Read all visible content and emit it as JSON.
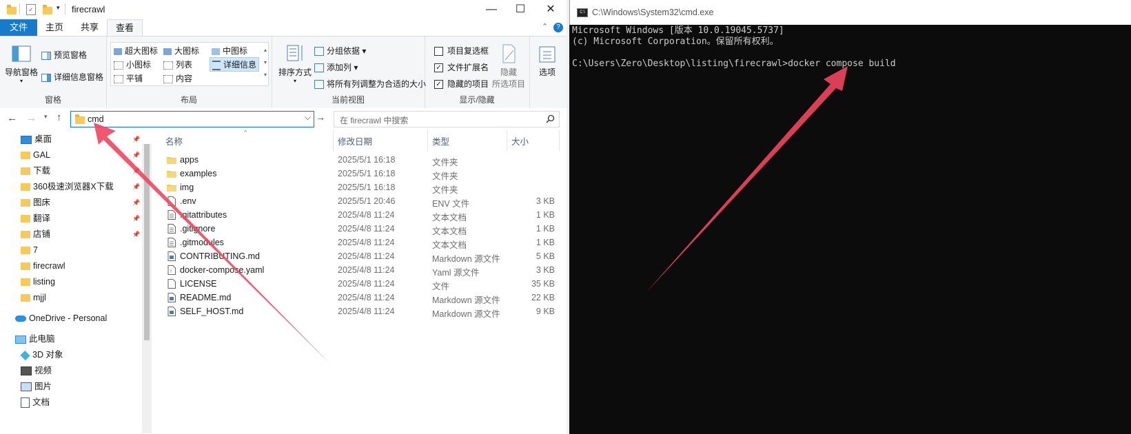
{
  "explorer": {
    "window_title": "firecrawl",
    "tabs": [
      {
        "label": "文件"
      },
      {
        "label": "主页"
      },
      {
        "label": "共享"
      },
      {
        "label": "查看"
      }
    ],
    "ribbon": {
      "pane": {
        "nav_pane": "导航窗格",
        "preview_pane": "预览窗格",
        "details_pane": "详细信息窗格",
        "group_label": "窗格"
      },
      "layout": {
        "xl_icons": "超大图标",
        "large_icons": "大图标",
        "medium_icons": "中图标",
        "small_icons": "小图标",
        "list": "列表",
        "details": "详细信息",
        "tiles": "平铺",
        "content": "内容",
        "group_label": "布局"
      },
      "current_view": {
        "sort_by": "排序方式",
        "group_by": "分组依据",
        "add_columns": "添加列",
        "size_all_columns": "将所有列调整为合适的大小",
        "group_label": "当前视图"
      },
      "show_hide": {
        "item_checkboxes": "项目复选框",
        "file_extensions": "文件扩展名",
        "hidden_items": "隐藏的项目",
        "hide": "隐藏",
        "hide_selected": "所选项目",
        "group_label": "显示/隐藏"
      },
      "options": "选项"
    },
    "address_value": "cmd",
    "search_placeholder": "在 firecrawl 中搜索",
    "sidebar": {
      "quick": [
        {
          "label": "桌面"
        },
        {
          "label": "GAL"
        },
        {
          "label": "下载"
        },
        {
          "label": "360极速浏览器X下载"
        },
        {
          "label": "图床"
        },
        {
          "label": "翻译"
        },
        {
          "label": "店铺"
        },
        {
          "label": "7"
        },
        {
          "label": "firecrawl"
        },
        {
          "label": "listing"
        },
        {
          "label": "mjjl"
        }
      ],
      "onedrive": "OneDrive - Personal",
      "this_pc": "此电脑",
      "pc_items": [
        {
          "label": "3D 对象"
        },
        {
          "label": "视频"
        },
        {
          "label": "图片"
        },
        {
          "label": "文档"
        }
      ]
    },
    "columns": {
      "name": "名称",
      "modified": "修改日期",
      "type": "类型",
      "size": "大小"
    },
    "files": [
      {
        "name": "apps",
        "date": "2025/5/1 16:18",
        "type": "文件夹",
        "size": "",
        "icon": "folder-icon"
      },
      {
        "name": "examples",
        "date": "2025/5/1 16:18",
        "type": "文件夹",
        "size": "",
        "icon": "folder-icon"
      },
      {
        "name": "img",
        "date": "2025/5/1 16:18",
        "type": "文件夹",
        "size": "",
        "icon": "folder-icon"
      },
      {
        "name": ".env",
        "date": "2025/5/1 20:46",
        "type": "ENV 文件",
        "size": "3 KB",
        "icon": "file-icon"
      },
      {
        "name": ".gitattributes",
        "date": "2025/4/8 11:24",
        "type": "文本文档",
        "size": "1 KB",
        "icon": "text-file-icon"
      },
      {
        "name": ".gitignore",
        "date": "2025/4/8 11:24",
        "type": "文本文档",
        "size": "1 KB",
        "icon": "text-file-icon"
      },
      {
        "name": ".gitmodules",
        "date": "2025/4/8 11:24",
        "type": "文本文档",
        "size": "1 KB",
        "icon": "text-file-icon"
      },
      {
        "name": "CONTRIBUTING.md",
        "date": "2025/4/8 11:24",
        "type": "Markdown 源文件",
        "size": "5 KB",
        "icon": "markdown-file-icon"
      },
      {
        "name": "docker-compose.yaml",
        "date": "2025/4/8 11:24",
        "type": "Yaml 源文件",
        "size": "3 KB",
        "icon": "yaml-file-icon"
      },
      {
        "name": "LICENSE",
        "date": "2025/4/8 11:24",
        "type": "文件",
        "size": "35 KB",
        "icon": "file-icon"
      },
      {
        "name": "README.md",
        "date": "2025/4/8 11:24",
        "type": "Markdown 源文件",
        "size": "22 KB",
        "icon": "markdown-file-icon"
      },
      {
        "name": "SELF_HOST.md",
        "date": "2025/4/8 11:24",
        "type": "Markdown 源文件",
        "size": "9 KB",
        "icon": "markdown-file-icon"
      }
    ]
  },
  "cmd": {
    "title": "C:\\Windows\\System32\\cmd.exe",
    "line1": "Microsoft Windows [版本 10.0.19045.5737]",
    "line2": "(c) Microsoft Corporation。保留所有权利。",
    "prompt": "C:\\Users\\Zero\\Desktop\\listing\\firecrawl>docker compose build"
  },
  "colors": {
    "accent": "#1979ca",
    "arrow": "#f2455e",
    "folder": "#f6c95b"
  }
}
